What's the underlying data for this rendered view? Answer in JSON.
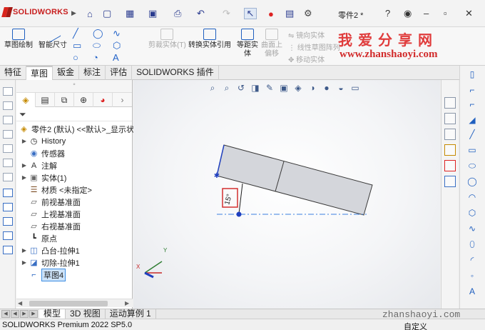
{
  "app": {
    "brand": "SOLIDWORKS",
    "document_title": "零件2 *",
    "help_icon": "help-icon",
    "user_icon": "user-icon"
  },
  "watermark": {
    "title": "我爱分享网",
    "url": "www.zhanshaoyi.com",
    "footer_url": "zhanshaoyi.com"
  },
  "ribbon": {
    "sketch": "草图绘制",
    "smart_dim": "智能尺寸",
    "trim": "剪裁实体(T)",
    "convert": "转换实体引用",
    "offset_line1": "等距实",
    "offset_line2": "体",
    "surface_line1": "曲面上",
    "surface_line2": "偏移",
    "mirror": "镜向实体",
    "linear_pattern": "线性草图阵列",
    "move": "移动实体"
  },
  "tabs": [
    "特征",
    "草图",
    "钣金",
    "标注",
    "评估",
    "SOLIDWORKS 插件"
  ],
  "active_tab": "草图",
  "tree": {
    "root": "零件2 (默认) <<默认>_显示状",
    "items": [
      {
        "label": "History",
        "icon": "history-icon",
        "expand": true
      },
      {
        "label": "传感器",
        "icon": "sensor-icon",
        "expand": false
      },
      {
        "label": "注解",
        "icon": "annotation-icon",
        "expand": true
      },
      {
        "label": "实体(1)",
        "icon": "solid-body-icon",
        "expand": true
      },
      {
        "label": "材质 <未指定>",
        "icon": "material-icon",
        "expand": false
      },
      {
        "label": "前视基准面",
        "icon": "plane-icon",
        "expand": false
      },
      {
        "label": "上视基准面",
        "icon": "plane-icon",
        "expand": false
      },
      {
        "label": "右视基准面",
        "icon": "plane-icon",
        "expand": false
      },
      {
        "label": "原点",
        "icon": "origin-icon",
        "expand": false
      },
      {
        "label": "凸台-拉伸1",
        "icon": "boss-extrude-icon",
        "expand": true
      },
      {
        "label": "切除-拉伸1",
        "icon": "cut-extrude-icon",
        "expand": true
      },
      {
        "label": "草图4",
        "icon": "sketch-icon",
        "expand": false
      }
    ]
  },
  "sketch": {
    "dimension": "15°"
  },
  "bottom_tabs": [
    "模型",
    "3D 视图",
    "运动算例 1"
  ],
  "status": {
    "left": "SOLIDWORKS Premium 2022 SP5.0",
    "right": "自定义"
  },
  "colors": {
    "accent": "#1f5fbf",
    "brand_red": "#c81e1e",
    "watermark_red": "#e03c3c",
    "dimension_box": "#d32f2f",
    "centerline": "#3b7fe0"
  }
}
